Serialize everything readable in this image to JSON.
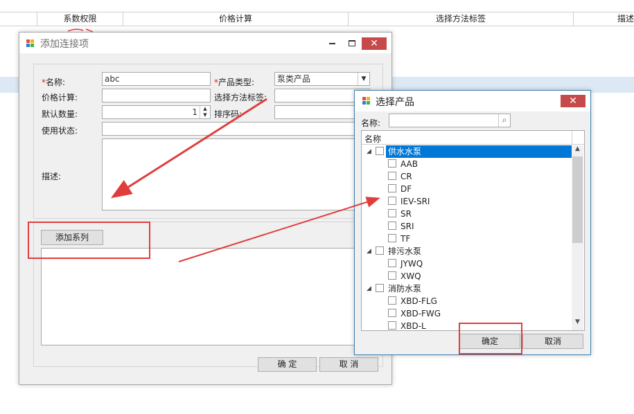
{
  "background_grid": {
    "columns": [
      "系数权限",
      "价格计算",
      "选择方法标签",
      "描述"
    ]
  },
  "main_dialog": {
    "title": "添加连接项",
    "fields": {
      "name_label": "名称:",
      "name_value": "abc",
      "product_type_label": "产品类型:",
      "product_type_value": "泵类产品",
      "price_calc_label": "价格计算:",
      "method_tag_label": "选择方法标签:",
      "default_qty_label": "默认数量:",
      "default_qty_value": "1",
      "sort_code_label": "排序码:",
      "status_label": "使用状态:",
      "description_label": "描述:"
    },
    "add_series_button": "添加系列",
    "ok_button": "确 定",
    "cancel_button": "取 消"
  },
  "product_dialog": {
    "title": "选择产品",
    "search_label": "名称:",
    "search_value": "",
    "column_header": "名称",
    "tree": [
      {
        "label": "供水水泵",
        "expanded": true,
        "selected": true,
        "children": [
          "AAB",
          "CR",
          "DF",
          "IEV-SRI",
          "SR",
          "SRI",
          "TF"
        ]
      },
      {
        "label": "排污水泵",
        "expanded": true,
        "selected": false,
        "children": [
          "JYWQ",
          "XWQ"
        ]
      },
      {
        "label": "消防水泵",
        "expanded": true,
        "selected": false,
        "children": [
          "XBD-FLG",
          "XBD-FWG",
          "XBD-L"
        ]
      }
    ],
    "ok_button": "确定",
    "cancel_button": "取消"
  },
  "colors": {
    "selection": "#0078d7",
    "close_button": "#c74a4a",
    "annotation": "#e03c3c"
  }
}
